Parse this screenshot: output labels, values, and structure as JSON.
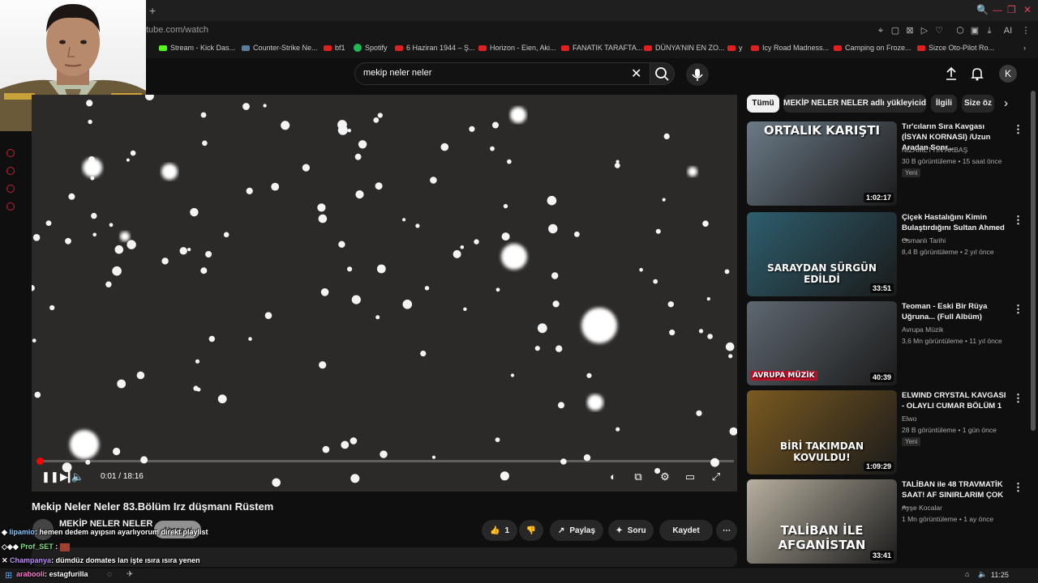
{
  "browser": {
    "url_host": "tube.com",
    "url_path": "/watch",
    "bookmarks": [
      "Stream - Kick Das...",
      "Counter-Strike Ne...",
      "bf1",
      "Spotify",
      "6 Haziran 1944 – Ş...",
      "Horizon - Eien, Aki...",
      "FANATIK TARAFTA...",
      "DÜNYA'NIN EN ZO...",
      "y",
      "Icy Road Madness...",
      "Camping on Froze...",
      "Sizce Oto-Pilot Ro..."
    ],
    "toolbar_ai_label": "AI"
  },
  "youtube": {
    "search_value": "mekip neler neler",
    "avatar_letter": "K"
  },
  "player": {
    "time_current": "0:01",
    "time_sep": " / ",
    "time_total": "18:16",
    "progress_fraction": 0.001
  },
  "video": {
    "title": "Mekip Neler Neler 83.Bölüm Irz düşmanı Rüstem",
    "channel": "MEKİP NELER NELER",
    "subscribe_label": "Abone ol",
    "like_count": "1",
    "share_label": "Paylaş",
    "ask_label": "Soru",
    "save_label": "Kaydet"
  },
  "chips": [
    "Tümü",
    "MEKİP NELER NELER adlı yükleyiciden",
    "İlgili",
    "Size öz"
  ],
  "recommendations": [
    {
      "title": "Tır'cıların Sıra Kavgası (İSYAN KORNASI) /Uzun Aradan Sonr...",
      "channel": "NİZAMETTİN AKBAŞ",
      "meta": "30 B görüntüleme • 15 saat önce",
      "badge": "Yeni",
      "duration": "1:02:17",
      "thumb_text": "ORTALIK KARIŞTI",
      "color": "#6b7a86"
    },
    {
      "title": "Çiçek Hastalığını Kimin Bulaştırdığını Sultan Ahmed ...",
      "channel": "Osmanlı Tarihi",
      "meta": "8,4 B görüntüleme • 2 yıl önce",
      "badge": "",
      "duration": "33:51",
      "thumb_text": "SARAYDAN SÜRGÜN EDİLDİ",
      "color": "#2e5e6e"
    },
    {
      "title": "Teoman - Eski Bir Rüya Uğruna... (Full Albüm)",
      "channel": "Avrupa Müzik",
      "meta": "3,6 Mn görüntüleme • 11 yıl önce",
      "badge": "",
      "duration": "40:39",
      "thumb_text": "AVRUPA MÜZİK",
      "color": "#5e6870"
    },
    {
      "title": "ELWIND CRYSTAL KAVGASI - OLAYLI CUMAR BÖLÜM 1",
      "channel": "Elwo",
      "meta": "28 B görüntüleme • 1 gün önce",
      "badge": "Yeni",
      "duration": "1:09:29",
      "thumb_text": "BİRİ TAKIMDAN KOVULDU!",
      "color": "#7a5a20"
    },
    {
      "title": "TALİBAN ile 48 TRAVMATİK SAAT! AF SINIRLARIM ÇOK ...",
      "channel": "Ayşe Kocalar",
      "meta": "1 Mn görüntüleme • 1 ay önce",
      "badge": "",
      "duration": "33:41",
      "thumb_text": "TALİBAN İLE AFGANİSTAN",
      "color": "#b8b0a0"
    }
  ],
  "chat": [
    {
      "user": "lipamio",
      "text": ": hemen dedem ayıpsın ayarlıyorum direkt playlist",
      "color": "#7ec8ff"
    },
    {
      "user": "Prof_SET",
      "text": " :",
      "color": "#7fe07f"
    },
    {
      "user": "Champanya",
      "text": ": dümdüz domates lan işte ısıra ısıra yenen",
      "color": "#c08cff"
    },
    {
      "user": "arabooli",
      "text": ": estagfurilla",
      "color": "#ff7ad0"
    }
  ],
  "taskbar_clock": "11:25"
}
